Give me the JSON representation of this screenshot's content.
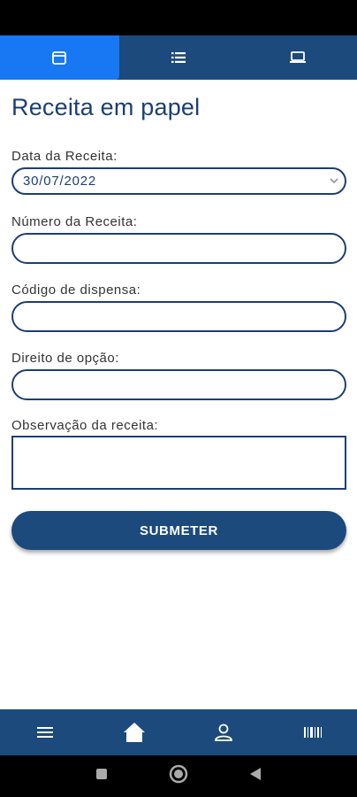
{
  "page": {
    "title": "Receita em papel"
  },
  "top_tabs": [
    {
      "icon": "calendar-icon",
      "active": true
    },
    {
      "icon": "list-icon",
      "active": false
    },
    {
      "icon": "laptop-icon",
      "active": false
    }
  ],
  "form": {
    "date_label": "Data da Receita:",
    "date_value": "30/07/2022",
    "number_label": "Número da Receita:",
    "number_value": "",
    "dispense_label": "Código de dispensa:",
    "dispense_value": "",
    "option_label": "Direito de opção:",
    "option_value": "",
    "observation_label": "Observação da receita:",
    "observation_value": "",
    "submit_label": "SUBMETER"
  },
  "bottom_nav": [
    {
      "icon": "menu-icon"
    },
    {
      "icon": "home-icon"
    },
    {
      "icon": "user-icon"
    },
    {
      "icon": "barcode-icon"
    }
  ],
  "colors": {
    "primary": "#1c4a7c",
    "active_tab": "#1877f2",
    "title": "#1c3f73"
  }
}
